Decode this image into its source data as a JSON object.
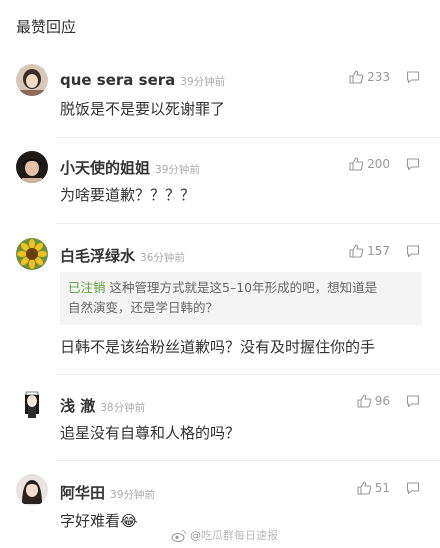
{
  "header": {
    "title": "最赞回应"
  },
  "comments": [
    {
      "name": "que sera sera",
      "time": "39分钟前",
      "likes": "233",
      "text": "脱饭是不是要以死谢罪了",
      "avatar": "avatar-girl-icon"
    },
    {
      "name": "小天使的姐姐",
      "time": "39分钟前",
      "likes": "200",
      "text": "为啥要道歉？？？？",
      "avatar": "avatar-girl-icon"
    },
    {
      "name": "白毛浮绿水",
      "time": "36分钟前",
      "likes": "157",
      "text": "日韩不是该给粉丝道歉吗？没有及时握住你的手",
      "avatar": "sunflower-icon",
      "quote": {
        "name": "已注销",
        "line1": "这种管理方式就是这5–10年形成的吧，想知道是",
        "line2": "自然演变，还是学日韩的？"
      }
    },
    {
      "name": "浅 澈",
      "time": "38分钟前",
      "likes": "96",
      "text": "追星没有自尊和人格的吗？",
      "avatar": "avatar-anime-icon"
    },
    {
      "name": "阿华田",
      "time": "39分钟前",
      "likes": "51",
      "text": "字好难看",
      "emoji": "😂",
      "avatar": "avatar-girl-icon"
    }
  ],
  "watermark": {
    "weibo": "@",
    "text": "吃瓜群每日速报"
  },
  "colors": {
    "name": "#333333",
    "time": "#aaaaaa",
    "quote_user": "#5fa13c",
    "quote_bg": "#f4f4f4"
  }
}
